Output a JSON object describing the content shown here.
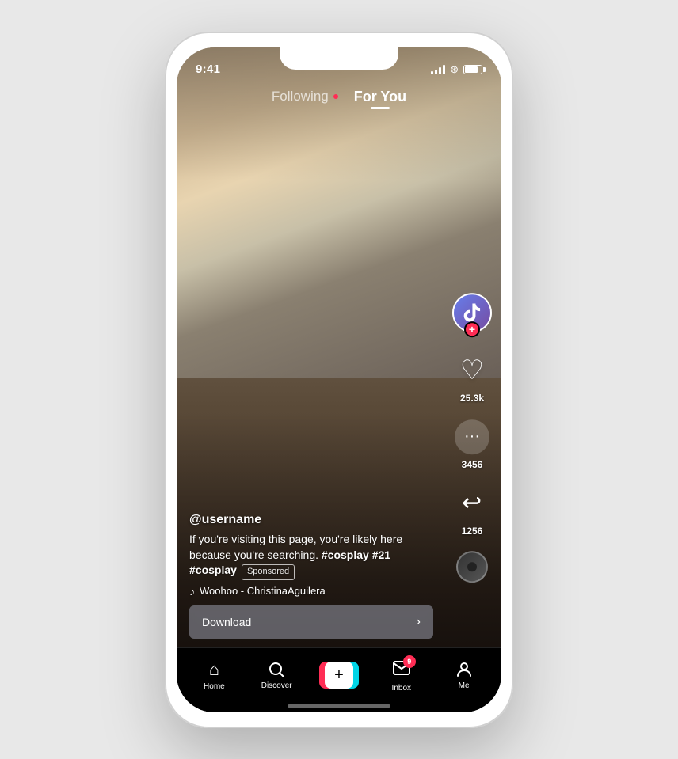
{
  "phone": {
    "status_bar": {
      "time": "9:41",
      "battery_label": "battery"
    },
    "nav": {
      "following_label": "Following",
      "for_you_label": "For You"
    },
    "sidebar": {
      "likes_count": "25.3k",
      "comments_count": "3456",
      "shares_count": "1256",
      "plus_symbol": "+"
    },
    "content": {
      "username": "@username",
      "caption_start": "If you're visiting this page, you're likely here because you're searching. ",
      "caption_bold": "#cosplay #21 #cosplay",
      "sponsored_label": "Sponsored",
      "music_note": "♪",
      "music_text": "Woohoo - ChristinaAguilera",
      "download_label": "Download",
      "download_arrow": "›"
    },
    "bottom_nav": {
      "home_label": "Home",
      "home_icon": "⌂",
      "discover_label": "Discover",
      "discover_icon": "🔍",
      "create_icon": "+",
      "inbox_label": "Inbox",
      "inbox_icon": "✉",
      "inbox_badge": "9",
      "me_label": "Me",
      "me_icon": "👤"
    }
  }
}
